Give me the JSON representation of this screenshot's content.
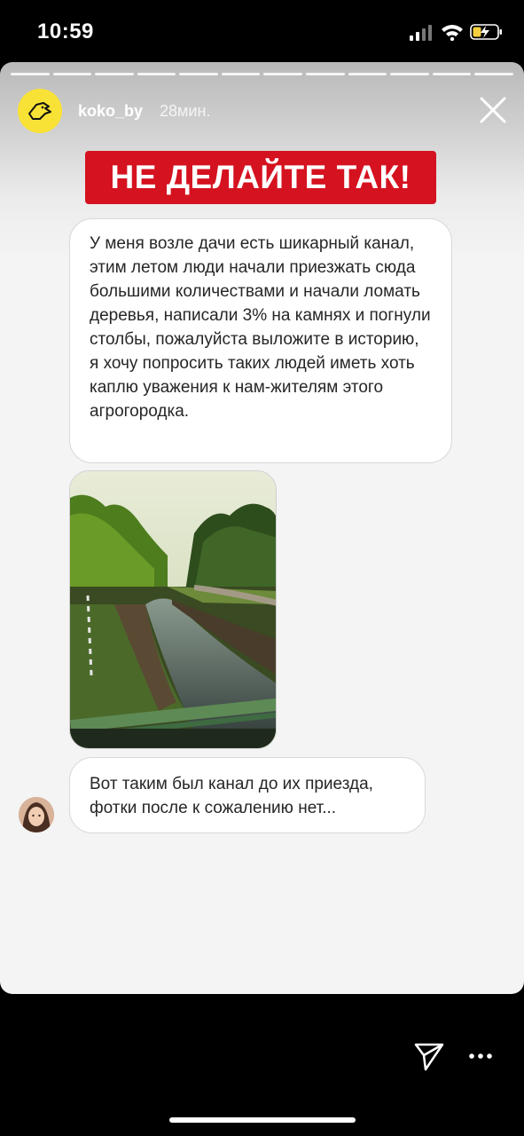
{
  "status_bar": {
    "time": "10:59"
  },
  "story": {
    "segments": 12,
    "author": {
      "username": "koko_by",
      "posted": "28мин."
    },
    "banner": "НЕ ДЕЛАЙТЕ ТАК!",
    "message_1": "У меня возле дачи есть шикарный канал, этим летом люди начали приезжать сюда большими количествами и начали ломать деревья, написали 3% на камнях и погнули столбы, пожалуйста выложите в историю, я хочу попросить таких людей иметь хоть каплю уважения к нам-жителям этого агрогородка.",
    "message_2": "Вот таким был канал до их приезда, фотки после к сожалению нет..."
  },
  "colors": {
    "banner": "#d5121f",
    "avatar": "#f9e236"
  },
  "icons": {
    "close": "close-icon",
    "send": "paper-plane-icon",
    "more": "more-dots-icon"
  }
}
